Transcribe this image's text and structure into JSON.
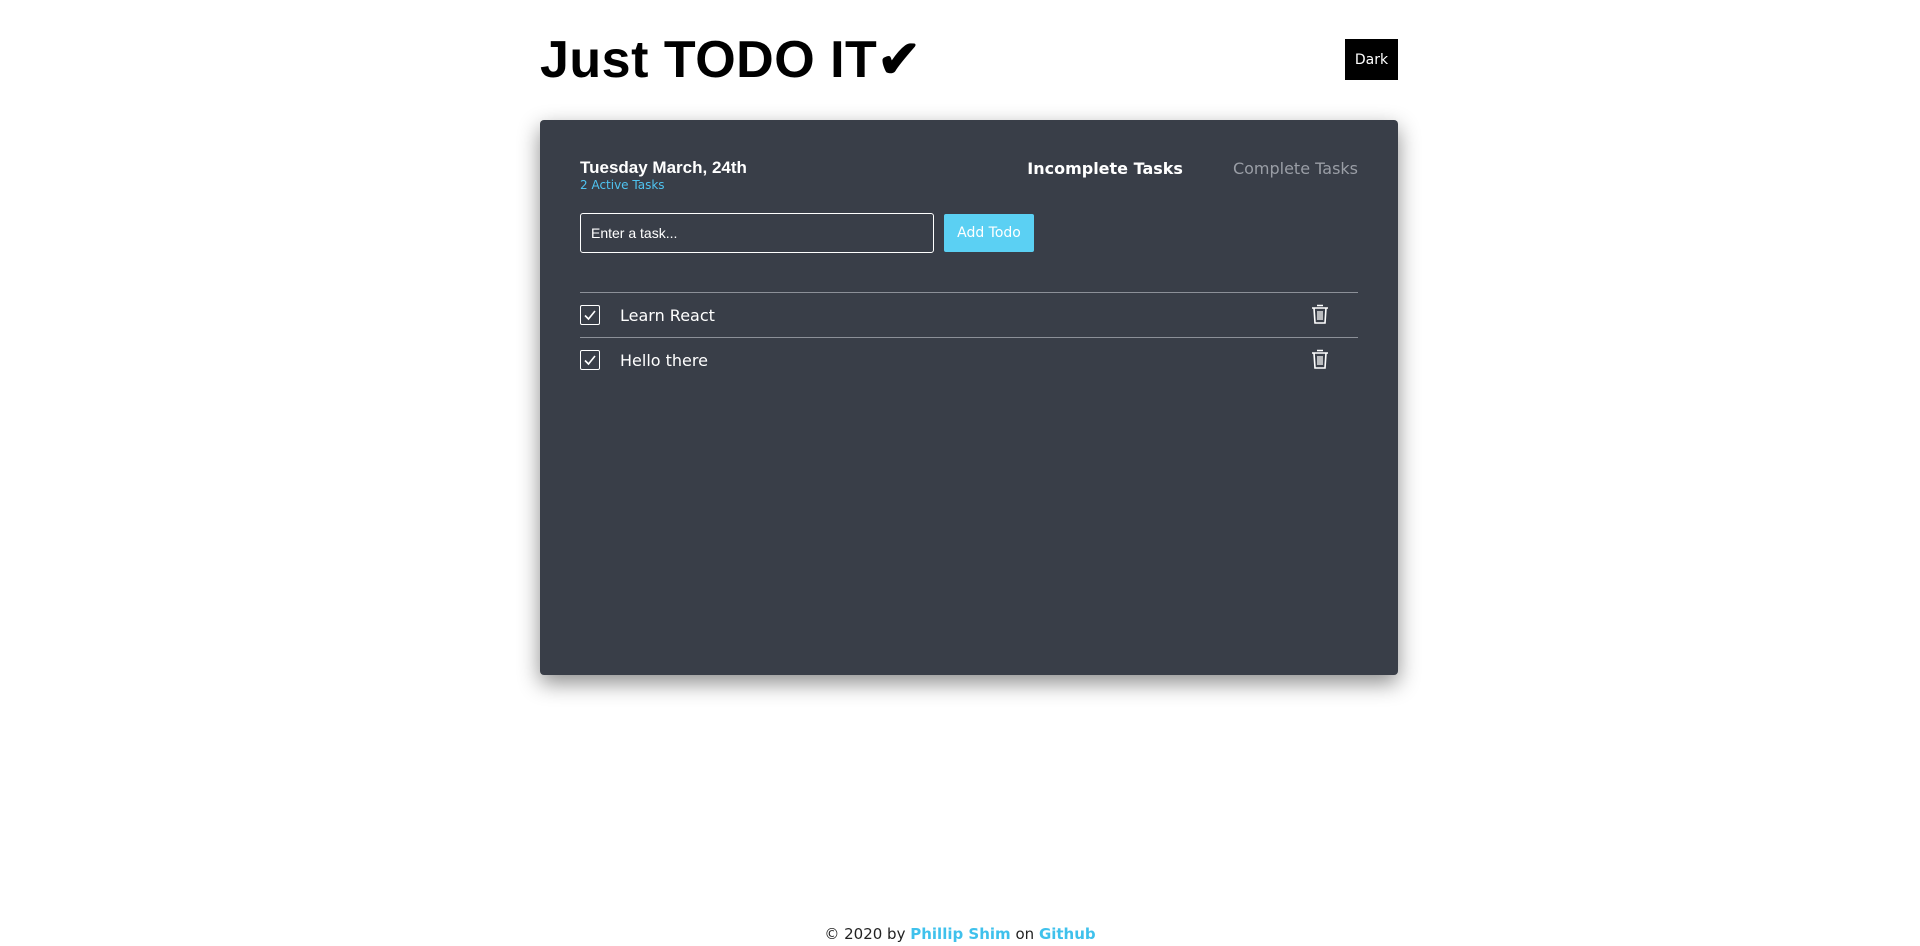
{
  "header": {
    "title": "Just TODO IT✔",
    "theme_button": "Dark"
  },
  "card": {
    "date": "Tuesday March, 24th",
    "active_count": "2 Active Tasks",
    "tabs": [
      {
        "label": "Incomplete Tasks",
        "active": true
      },
      {
        "label": "Complete Tasks",
        "active": false
      }
    ],
    "input": {
      "placeholder": "Enter a task...",
      "value": ""
    },
    "add_button": "Add Todo",
    "todos": [
      {
        "text": "Learn React",
        "checked": true,
        "icon": "trash-icon"
      },
      {
        "text": "Hello there",
        "checked": true,
        "icon": "trash-icon"
      }
    ]
  },
  "footer": {
    "prefix": "© 2020 by",
    "author": "Phillip Shim",
    "middle": "on",
    "link": "Github"
  },
  "colors": {
    "card_bg": "#393e48",
    "accent": "#5bd0f3",
    "active_count": "#4fc3f0"
  }
}
